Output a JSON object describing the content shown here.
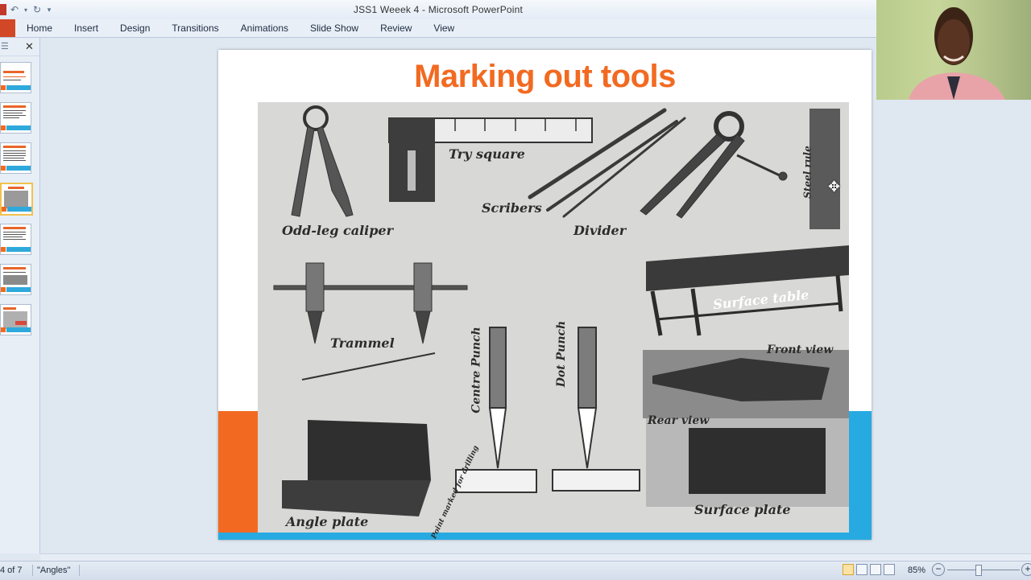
{
  "window": {
    "title": "JSS1 Weeek 4  -  Microsoft PowerPoint"
  },
  "quick_access": {
    "icons": [
      "save-icon",
      "undo-icon",
      "redo-icon",
      "customize-icon"
    ]
  },
  "ribbon": {
    "tabs": [
      "Home",
      "Insert",
      "Design",
      "Transitions",
      "Animations",
      "Slide Show",
      "Review",
      "View"
    ]
  },
  "slides_panel": {
    "slide_count": 7,
    "selected_index": 4
  },
  "slide": {
    "title": "Marking out tools",
    "image_labels": {
      "try_square": "Try square",
      "scribers": "Scribers",
      "odd_leg": "Odd-leg caliper",
      "divider": "Divider",
      "steel_rule": "Steel rule",
      "surface_table": "Surface table",
      "trammel": "Trammel",
      "centre_punch": "Centre Punch",
      "dot_punch": "Dot Punch",
      "front_view": "Front view",
      "rear_view": "Rear view",
      "surface_plate": "Surface plate",
      "angle_plate": "Angle plate",
      "point_marked": "Point marked for drilling"
    },
    "colors": {
      "title": "#f26a21",
      "band_orange": "#f26a21",
      "band_blue": "#27aae1"
    }
  },
  "status": {
    "slide_info": "4 of 7",
    "theme": "\"Angles\"",
    "zoom": "85%"
  }
}
